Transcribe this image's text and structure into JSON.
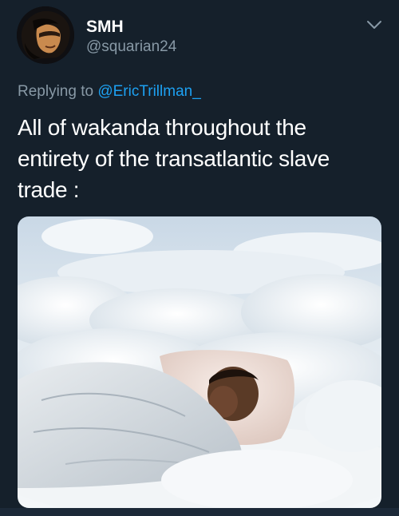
{
  "tweet": {
    "display_name": "SMH",
    "handle": "@squarian24",
    "reply_prefix": "Replying to",
    "reply_to": "@EricTrillman_",
    "text": "All of wakanda throughout the entirety of the transatlantic slave trade :"
  },
  "icons": {
    "menu": "chevron-down-icon"
  },
  "colors": {
    "background": "#15202b",
    "secondary_text": "#8899a6",
    "link": "#1da1f2",
    "primary_text": "#ffffff"
  }
}
